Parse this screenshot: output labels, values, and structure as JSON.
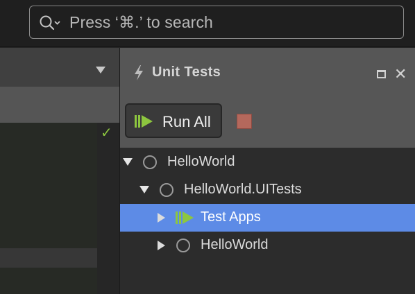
{
  "search": {
    "placeholder": "Press ‘⌘.’ to search"
  },
  "editor": {
    "status_icon": "checkmark-icon",
    "status_color": "#8dc63f"
  },
  "unit_tests_pad": {
    "title": "Unit Tests",
    "toolbar": {
      "run_all_label": "Run All",
      "stop_color": "#b4685c"
    },
    "tree": [
      {
        "label": "HelloWorld",
        "expanded": true,
        "status": "not-run"
      },
      {
        "label": "HelloWorld.UITests",
        "expanded": true,
        "status": "not-run"
      },
      {
        "label": "Test Apps",
        "expanded": false,
        "status": "running",
        "selected": true
      },
      {
        "label": "HelloWorld",
        "expanded": false,
        "status": "not-run"
      }
    ]
  },
  "colors": {
    "selection": "#5d8be6",
    "run_green": "#8dc63f",
    "pad_header": "#565656"
  }
}
